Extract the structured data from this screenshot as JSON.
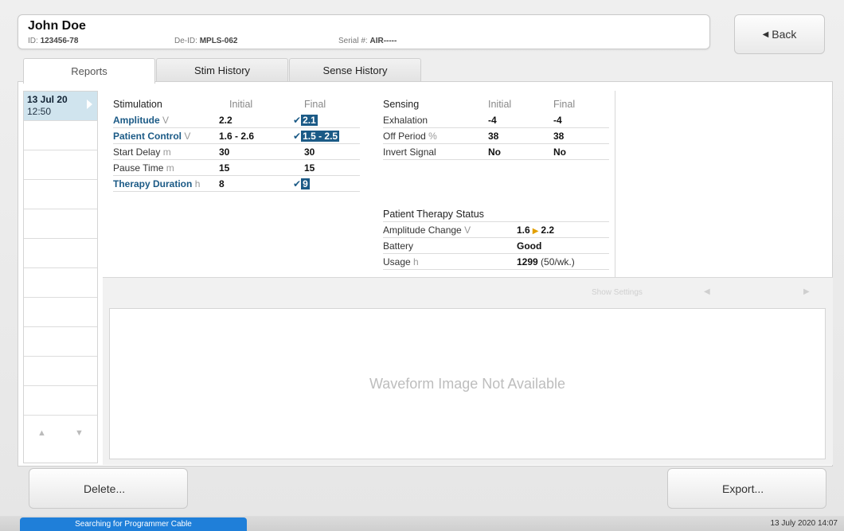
{
  "patient": {
    "name": "John Doe",
    "id_label": "ID:",
    "id_value": "123456-78",
    "deid_label": "De-ID:",
    "deid_value": "MPLS-062",
    "serial_label": "Serial #:",
    "serial_value": "AIR-----"
  },
  "back_label": "Back",
  "tabs": [
    {
      "label": "Reports",
      "active": true
    },
    {
      "label": "Stim History",
      "active": false
    },
    {
      "label": "Sense History",
      "active": false
    }
  ],
  "reports": [
    {
      "date": "13 Jul 20",
      "time": "12:50",
      "selected": true
    }
  ],
  "stimulation": {
    "title": "Stimulation",
    "col_initial": "Initial",
    "col_final": "Final",
    "rows": [
      {
        "label": "Amplitude",
        "unit": "V",
        "initial": "2.2",
        "final": "2.1",
        "highlight": true,
        "changed": true
      },
      {
        "label": "Patient Control",
        "unit": "V",
        "initial": "1.6 - 2.6",
        "final": "1.5 - 2.5",
        "highlight": true,
        "changed": true
      },
      {
        "label": "Start Delay",
        "unit": "m",
        "initial": "30",
        "final": "30",
        "highlight": false,
        "changed": false
      },
      {
        "label": "Pause Time",
        "unit": "m",
        "initial": "15",
        "final": "15",
        "highlight": false,
        "changed": false
      },
      {
        "label": "Therapy Duration",
        "unit": "h",
        "initial": "8",
        "final": "9",
        "highlight": true,
        "changed": true
      }
    ]
  },
  "sensing": {
    "title": "Sensing",
    "col_initial": "Initial",
    "col_final": "Final",
    "rows": [
      {
        "label": "Exhalation",
        "unit": "",
        "initial": "-4",
        "final": "-4"
      },
      {
        "label": "Off Period",
        "unit": "%",
        "initial": "38",
        "final": "38"
      },
      {
        "label": "Invert Signal",
        "unit": "",
        "initial": "No",
        "final": "No"
      }
    ]
  },
  "therapy_status": {
    "title": "Patient Therapy Status",
    "amp_label": "Amplitude Change",
    "amp_unit": "V",
    "amp_from": "1.6",
    "amp_to": "2.2",
    "battery_label": "Battery",
    "battery_value": "Good",
    "usage_label": "Usage",
    "usage_unit": "h",
    "usage_value": "1299",
    "usage_extra": "(50/wk.)"
  },
  "waveform": {
    "show_settings": "Show Settings",
    "message": "Waveform Image Not Available"
  },
  "buttons": {
    "delete": "Delete...",
    "export": "Export..."
  },
  "status": {
    "message": "Searching for Programmer Cable",
    "datetime": "13 July 2020 14:07"
  },
  "colors": {
    "accent": "#1b5a86",
    "status_bar": "#1f7fd9",
    "selected_row": "#d0e4ee",
    "arrow": "#e2a000"
  }
}
